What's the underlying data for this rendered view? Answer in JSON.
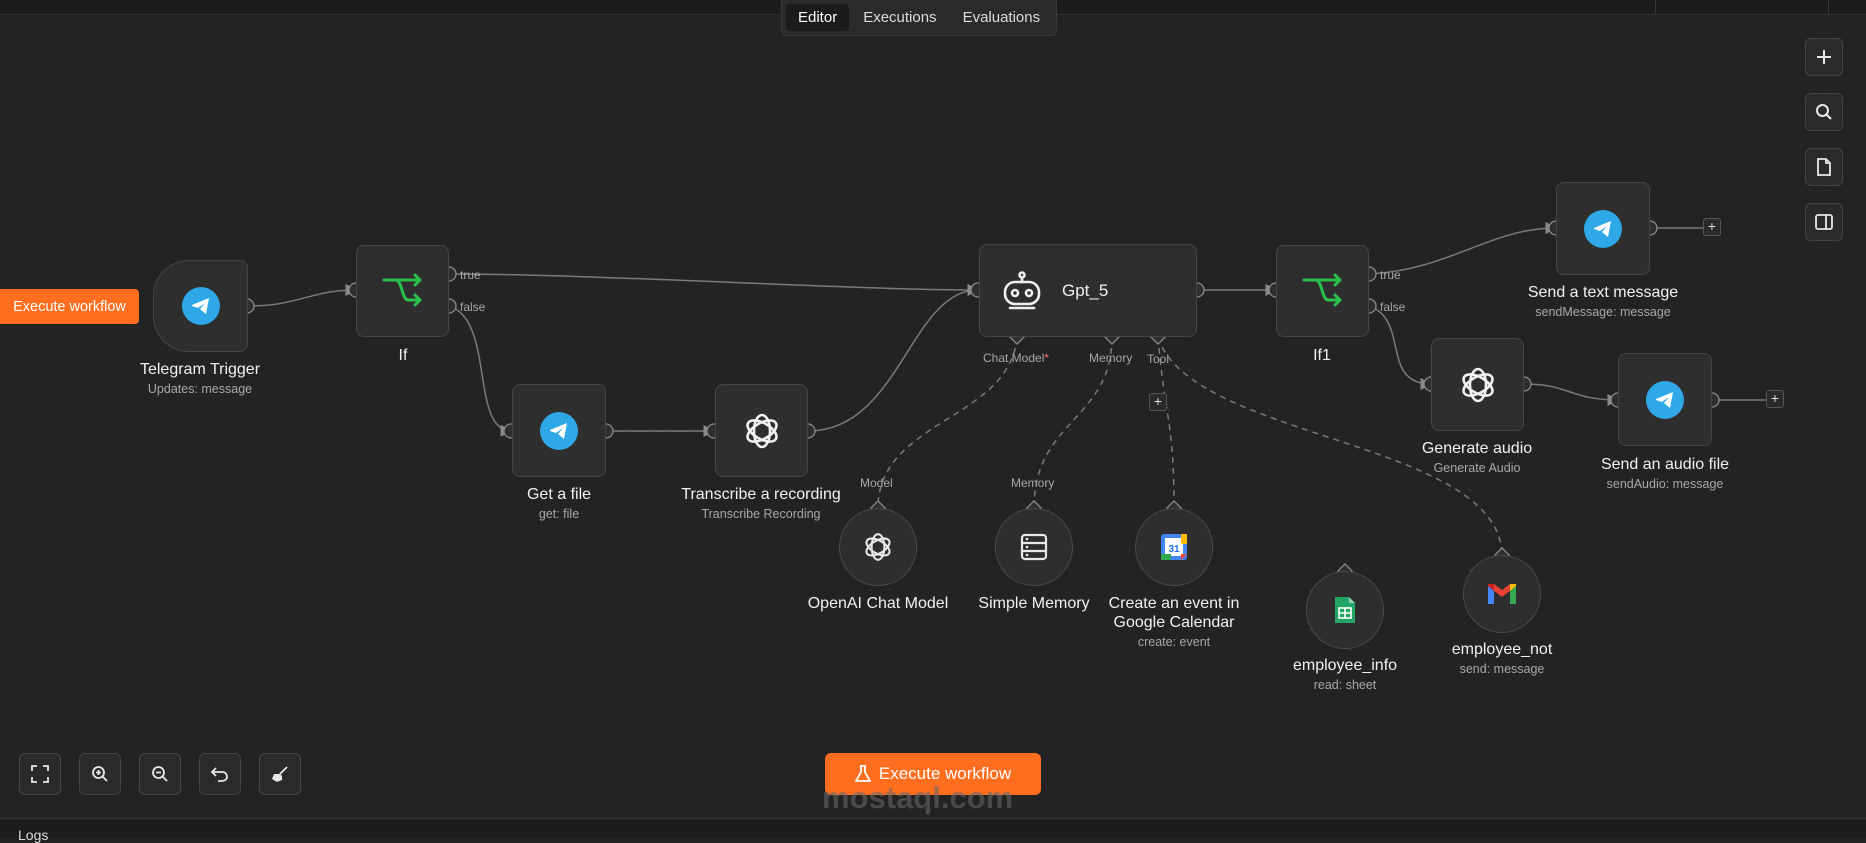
{
  "tabs": [
    "Editor",
    "Executions",
    "Evaluations"
  ],
  "execute_side_label": "Execute workflow",
  "execute_main_label": "Execute workflow",
  "watermark": "mostaql.com",
  "logs_label": "Logs",
  "nodes": {
    "telegram_trigger": {
      "title": "Telegram Trigger",
      "subtitle": "Updates: message"
    },
    "if": {
      "title": "If"
    },
    "get_file": {
      "title": "Get a file",
      "subtitle": "get: file"
    },
    "transcribe": {
      "title": "Transcribe a recording",
      "subtitle": "Transcribe Recording"
    },
    "gpt5": {
      "title": "Gpt_5"
    },
    "if1": {
      "title": "If1"
    },
    "send_text": {
      "title": "Send a text message",
      "subtitle": "sendMessage: message"
    },
    "generate_audio": {
      "title": "Generate audio",
      "subtitle": "Generate Audio"
    },
    "send_audio": {
      "title": "Send an audio file",
      "subtitle": "sendAudio: message"
    },
    "openai_chat_model": {
      "title": "OpenAI Chat Model"
    },
    "simple_memory": {
      "title": "Simple Memory"
    },
    "calendar": {
      "title_line1": "Create an event in",
      "title_line2": "Google Calendar",
      "subtitle": "create: event"
    },
    "employee_info": {
      "title": "employee_info",
      "subtitle": "read: sheet"
    },
    "employee_not": {
      "title": "employee_not",
      "subtitle": "send: message"
    }
  },
  "ports": {
    "true": "true",
    "false": "false",
    "chat_model": "Chat Model",
    "required_mark": "*",
    "memory": "Memory",
    "tool": "Tool",
    "model": "Model",
    "memory_in": "Memory"
  },
  "calendar_day": "31",
  "colors": {
    "accent": "#ff6d1f",
    "telegram": "#2ea8e6",
    "if_green": "#27c24c"
  }
}
